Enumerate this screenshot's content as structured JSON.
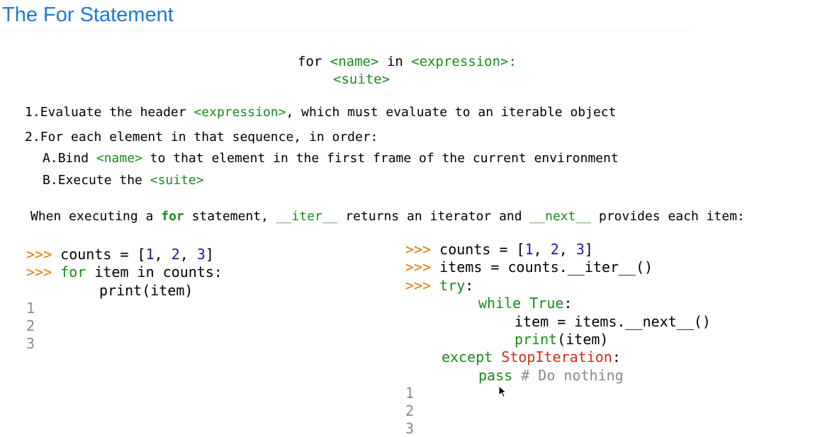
{
  "title": "The For Statement",
  "syntax": {
    "line1": {
      "kw_for": "for",
      "name": "<name>",
      "kw_in": "in",
      "expr": "<expression>:"
    },
    "line2": "<suite>"
  },
  "steps": {
    "s1": {
      "num": "1.",
      "pre": "Evaluate the header ",
      "expr": "<expression>",
      "post": ", which must evaluate to an iterable object"
    },
    "s2": {
      "num": "2.",
      "text": "For each element in that sequence, in order:"
    },
    "sA": {
      "num": "A.",
      "pre": "Bind ",
      "name": "<name>",
      "post": " to that element in the first frame of the current environment"
    },
    "sB": {
      "num": "B.",
      "pre": "Execute the ",
      "suite": "<suite>"
    }
  },
  "when": {
    "pre": "When executing a ",
    "kw_for": "for",
    "mid1": " statement, ",
    "iter": "__iter__",
    "mid2": " returns an iterator and ",
    "next": "__next__",
    "post": " provides each item:"
  },
  "left_code": {
    "prompt": ">>>",
    "l1_pre": "counts = [",
    "n1": "1",
    "c1": ", ",
    "n2": "2",
    "c2": ", ",
    "n3": "3",
    "close": "]",
    "l2_kw": "for",
    "l2_rest": " item in counts:",
    "l3": "print(item)",
    "outputs": [
      "1",
      "2",
      "3"
    ]
  },
  "right_code": {
    "prompt": ">>>",
    "l1_pre": "counts = [",
    "n1": "1",
    "c1": ", ",
    "n2": "2",
    "c2": ", ",
    "n3": "3",
    "close": "]",
    "l2": "items = counts.__iter__()",
    "l3_kw": "try",
    "l3_colon": ":",
    "l4_kw": "while",
    "l4_true": " True",
    "l4_colon": ":",
    "l5": "item = items.__next__()",
    "l6_kw": "print",
    "l6_rest": "(item)",
    "l7_kw": "except",
    "l7_exc": " StopIteration",
    "l7_colon": ":",
    "l8_kw": "pass",
    "l8_comment": " # Do nothing",
    "outputs": [
      "1",
      "2",
      "3"
    ]
  }
}
